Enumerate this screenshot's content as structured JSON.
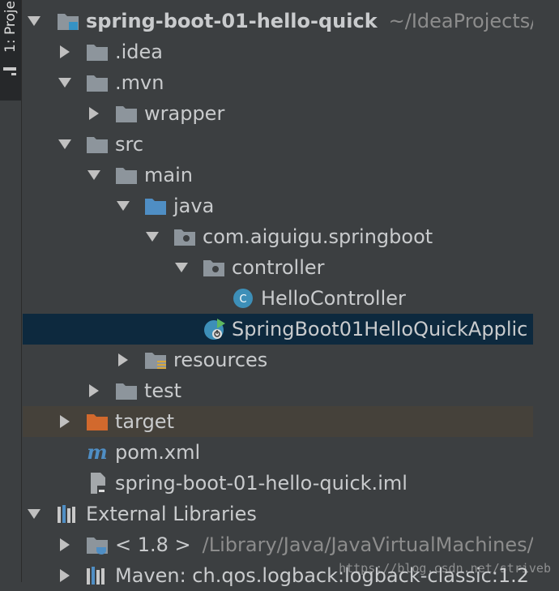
{
  "side_panel": {
    "tab_label": "1: Proje"
  },
  "tree": {
    "root": {
      "name": "spring-boot-01-hello-quick",
      "path": "~/IdeaProjects/"
    },
    "idea": "idea_dot",
    "items": {
      "idea": ".idea",
      "mvn": ".mvn",
      "wrapper": "wrapper",
      "src": "src",
      "main": "main",
      "java": "java",
      "package": "com.aiguigu.springboot",
      "controller": "controller",
      "hello_controller": "HelloController",
      "app_class": "SpringBoot01HelloQuickApplic",
      "resources": "resources",
      "test": "test",
      "target": "target",
      "pom": "pom.xml",
      "iml": "spring-boot-01-hello-quick.iml",
      "external_libraries": "External Libraries",
      "jdk": "< 1.8 >",
      "jdk_path": "/Library/Java/JavaVirtualMachines/",
      "maven_lib": "Maven: ch.qos.logback:logback-classic:1.2"
    }
  },
  "colors": {
    "background": "#3c3f41",
    "selected_row": "#0d293e",
    "excluded_row": "#45413a",
    "folder": "#8d959c",
    "source_folder": "#4f8ec4",
    "excluded_folder": "#d2692d",
    "class_icon": "#3d8fb8"
  },
  "watermark": "https://blog.csdn.net/striveb"
}
